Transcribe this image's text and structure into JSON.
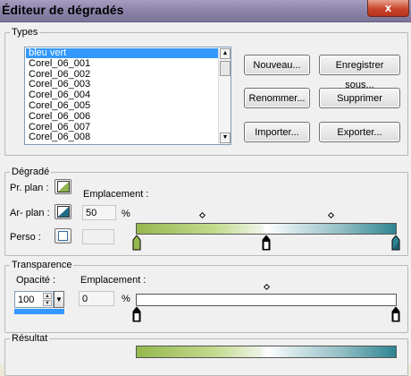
{
  "window": {
    "title": "Éditeur de dégradés",
    "close_glyph": "x"
  },
  "types": {
    "legend": "Types",
    "items": [
      "bleu vert",
      "Corel_06_001",
      "Corel_06_002",
      "Corel_06_003",
      "Corel_06_004",
      "Corel_06_005",
      "Corel_06_006",
      "Corel_06_007",
      "Corel_06_008"
    ],
    "selected_index": 0,
    "buttons": {
      "new": "Nouveau...",
      "save_as": "Enregistrer sous...",
      "rename": "Renommer...",
      "delete": "Supprimer",
      "import": "Importer...",
      "export": "Exporter..."
    }
  },
  "gradient": {
    "legend": "Dégradé",
    "foreground_label": "Pr. plan :",
    "background_label": "Ar- plan :",
    "custom_label": "Perso :",
    "location_label": "Emplacement :",
    "location_value": "50",
    "percent": "%",
    "colors": {
      "start": "#96b84f",
      "mid": "#ffffff",
      "end": "#2e8591"
    },
    "stops_percent": [
      0,
      50,
      100
    ],
    "midpoints_percent": [
      25,
      75
    ]
  },
  "transparency": {
    "legend": "Transparence",
    "opacity_label": "Opacité :",
    "opacity_value": "100",
    "location_label": "Emplacement :",
    "location_value": "0",
    "percent": "%",
    "stops_percent": [
      0,
      100
    ],
    "midpoints_percent": [
      50
    ]
  },
  "result": {
    "legend": "Résultat"
  },
  "icons": {
    "scroll_up": "▲",
    "scroll_down": "▼",
    "spin_up": "▲",
    "spin_down": "▼",
    "dropdown": "▼"
  }
}
